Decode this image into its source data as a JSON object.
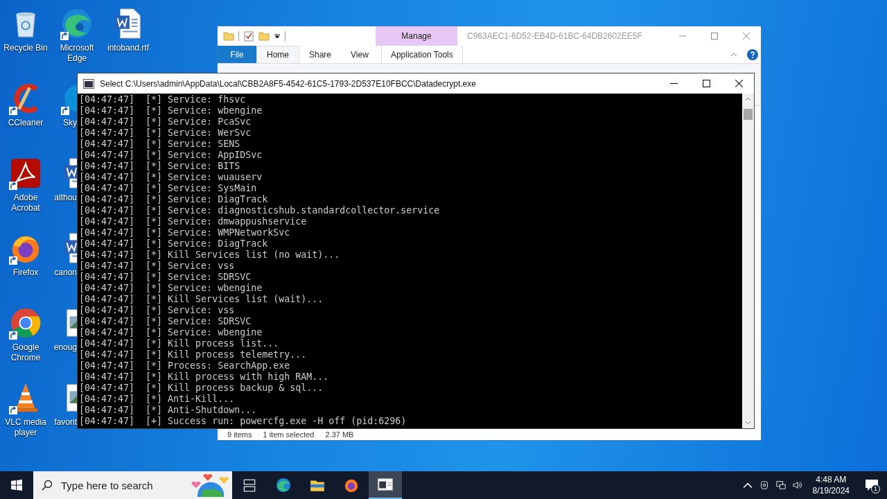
{
  "desktop": {
    "columns": [
      [
        {
          "label": "Recycle Bin",
          "kind": "recycle",
          "shortcut": false,
          "clipped": false
        },
        {
          "label": "CCleaner",
          "kind": "ccleaner",
          "shortcut": true,
          "clipped": false
        },
        {
          "label": "Adobe Acrobat",
          "kind": "acrobat",
          "shortcut": true,
          "clipped": false
        },
        {
          "label": "Firefox",
          "kind": "firefox",
          "shortcut": true,
          "clipped": false
        },
        {
          "label": "Google Chrome",
          "kind": "chrome",
          "shortcut": true,
          "clipped": false
        },
        {
          "label": "VLC media player",
          "kind": "vlc",
          "shortcut": true,
          "clipped": false
        }
      ],
      [
        {
          "label": "Microsoft Edge",
          "kind": "edge",
          "shortcut": true,
          "clipped": false
        },
        {
          "label": "Sky",
          "kind": "skype",
          "shortcut": true,
          "clipped": true
        },
        {
          "label": "althou",
          "kind": "word",
          "shortcut": false,
          "clipped": true
        },
        {
          "label": "canon",
          "kind": "word",
          "shortcut": false,
          "clipped": true
        },
        {
          "label": "enoug",
          "kind": "image",
          "shortcut": false,
          "clipped": true
        },
        {
          "label": "favorit",
          "kind": "image",
          "shortcut": false,
          "clipped": true
        }
      ],
      [
        {
          "label": "intoband.rtf",
          "kind": "word",
          "shortcut": false,
          "clipped": false
        }
      ]
    ]
  },
  "explorer": {
    "title": "C963AEC1-6D52-EB4D-61BC-64DB2602EE5F",
    "context_group": "Manage",
    "tabs": [
      {
        "label": "File",
        "kind": "file",
        "selected": false
      },
      {
        "label": "Home",
        "kind": "tab",
        "selected": true
      },
      {
        "label": "Share",
        "kind": "tab",
        "selected": false
      },
      {
        "label": "View",
        "kind": "tab",
        "selected": false
      },
      {
        "label": "Application Tools",
        "kind": "context",
        "selected": false
      }
    ],
    "status_bar": {
      "items": "9 items",
      "selection": "1 item selected",
      "size": "2.37 MB"
    }
  },
  "console": {
    "title": "Select C:\\Users\\admin\\AppData\\Local\\CBB2A8F5-4542-61C5-1793-2D537E10FBCC\\Datadecrypt.exe",
    "lines": [
      {
        "time": "[04:47:47]",
        "marker": "[*]",
        "text": "Service: fhsvc"
      },
      {
        "time": "[04:47:47]",
        "marker": "[*]",
        "text": "Service: wbengine"
      },
      {
        "time": "[04:47:47]",
        "marker": "[*]",
        "text": "Service: PcaSvc"
      },
      {
        "time": "[04:47:47]",
        "marker": "[*]",
        "text": "Service: WerSvc"
      },
      {
        "time": "[04:47:47]",
        "marker": "[*]",
        "text": "Service: SENS"
      },
      {
        "time": "[04:47:47]",
        "marker": "[*]",
        "text": "Service: AppIDSvc"
      },
      {
        "time": "[04:47:47]",
        "marker": "[*]",
        "text": "Service: BITS"
      },
      {
        "time": "[04:47:47]",
        "marker": "[*]",
        "text": "Service: wuauserv"
      },
      {
        "time": "[04:47:47]",
        "marker": "[*]",
        "text": "Service: SysMain"
      },
      {
        "time": "[04:47:47]",
        "marker": "[*]",
        "text": "Service: DiagTrack"
      },
      {
        "time": "[04:47:47]",
        "marker": "[*]",
        "text": "Service: diagnosticshub.standardcollector.service"
      },
      {
        "time": "[04:47:47]",
        "marker": "[*]",
        "text": "Service: dmwappushservice"
      },
      {
        "time": "[04:47:47]",
        "marker": "[*]",
        "text": "Service: WMPNetworkSvc"
      },
      {
        "time": "[04:47:47]",
        "marker": "[*]",
        "text": "Service: DiagTrack"
      },
      {
        "time": "[04:47:47]",
        "marker": "[*]",
        "text": "Kill Services list (no wait)..."
      },
      {
        "time": "[04:47:47]",
        "marker": "[*]",
        "text": "Service: vss"
      },
      {
        "time": "[04:47:47]",
        "marker": "[*]",
        "text": "Service: SDRSVC"
      },
      {
        "time": "[04:47:47]",
        "marker": "[*]",
        "text": "Service: wbengine"
      },
      {
        "time": "[04:47:47]",
        "marker": "[*]",
        "text": "Kill Services list (wait)..."
      },
      {
        "time": "[04:47:47]",
        "marker": "[*]",
        "text": "Service: vss"
      },
      {
        "time": "[04:47:47]",
        "marker": "[*]",
        "text": "Service: SDRSVC"
      },
      {
        "time": "[04:47:47]",
        "marker": "[*]",
        "text": "Service: wbengine"
      },
      {
        "time": "[04:47:47]",
        "marker": "[*]",
        "text": "Kill process list..."
      },
      {
        "time": "[04:47:47]",
        "marker": "[*]",
        "text": "Kill process telemetry..."
      },
      {
        "time": "[04:47:47]",
        "marker": "[*]",
        "text": "Process: SearchApp.exe"
      },
      {
        "time": "[04:47:47]",
        "marker": "[*]",
        "text": "Kill process with high RAM..."
      },
      {
        "time": "[04:47:47]",
        "marker": "[*]",
        "text": "Kill process backup & sql..."
      },
      {
        "time": "[04:47:47]",
        "marker": "[*]",
        "text": "Anti-Kill..."
      },
      {
        "time": "[04:47:47]",
        "marker": "[*]",
        "text": "Anti-Shutdown..."
      },
      {
        "time": "[04:47:47]",
        "marker": "[+]",
        "text": "Success run: powercfg.exe -H off (pid:6296)"
      }
    ]
  },
  "taskbar": {
    "search": {
      "placeholder": "Type here to search"
    },
    "apps": [
      {
        "kind": "taskview",
        "selected": false
      },
      {
        "kind": "edge",
        "selected": false
      },
      {
        "kind": "folder",
        "selected": false
      },
      {
        "kind": "firefox",
        "selected": false
      },
      {
        "kind": "console",
        "selected": true
      }
    ],
    "time": "4:48 AM",
    "date": "8/19/2024",
    "notifications": "1"
  }
}
